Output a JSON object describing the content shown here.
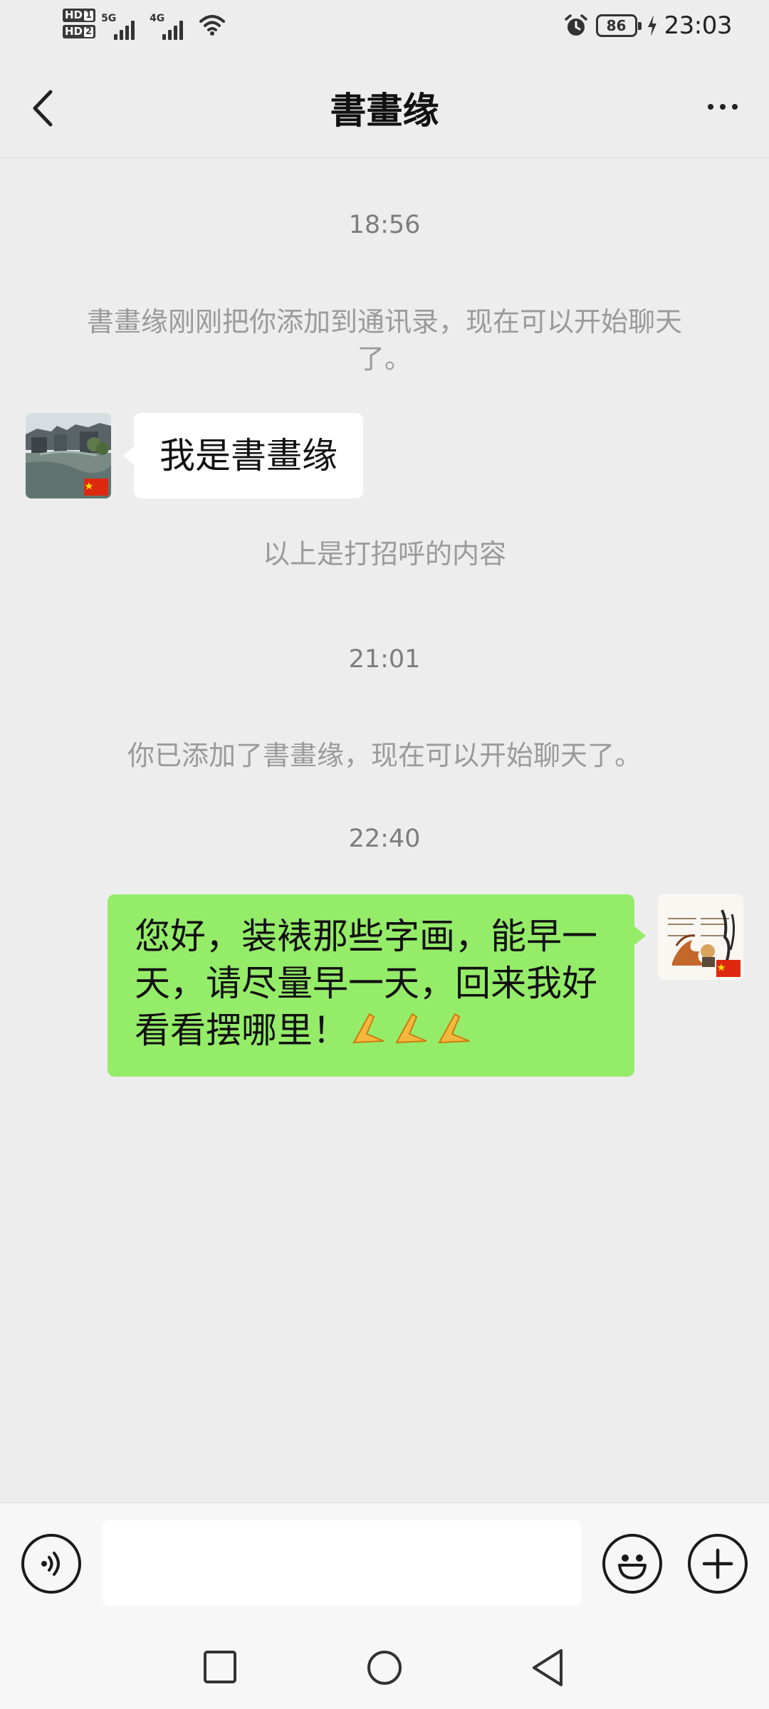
{
  "status_bar": {
    "sim1_label": "HD",
    "sim1_slot": "1",
    "sim2_label": "HD",
    "sim2_slot": "2",
    "network1": "5G",
    "network2": "4G",
    "alarm_icon": "alarm-icon",
    "battery_level": "86",
    "charging_icon": "bolt-icon",
    "time": "23:03"
  },
  "header": {
    "title": "書畫缘",
    "back_icon": "chevron-left-icon",
    "more_icon": "more-horizontal-icon"
  },
  "chat": {
    "time_1": "18:56",
    "system_added": "書畫缘刚刚把你添加到通讯录，现在可以开始聊天了。",
    "contact_greeting": "我是書畫缘",
    "greeting_note": "以上是打招呼的内容",
    "time_2": "21:01",
    "system_you_added": "你已添加了書畫缘，现在可以开始聊天了。",
    "time_3": "22:40",
    "my_message": "您好，装裱那些字画，能早一天，请尽量早一天，回来我好看看摆哪里！",
    "my_message_emoji": "folded-hands-emoji x3"
  },
  "input_bar": {
    "voice_icon": "voice-icon",
    "input_value": "",
    "emoji_icon": "smiley-icon",
    "add_icon": "plus-icon"
  },
  "nav_bar": {
    "recents_icon": "square-icon",
    "home_icon": "circle-icon",
    "back_icon": "triangle-back-icon"
  }
}
